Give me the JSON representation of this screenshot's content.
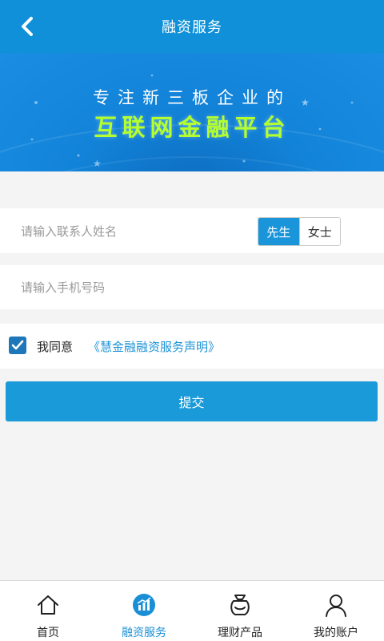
{
  "header": {
    "title": "融资服务",
    "back_icon": "chevron-left-icon"
  },
  "banner": {
    "line1": "专注新三板企业的",
    "line2": "互联网金融平台"
  },
  "form": {
    "name_placeholder": "请输入联系人姓名",
    "gender_options": [
      "先生",
      "女士"
    ],
    "gender_selected": "先生",
    "phone_placeholder": "请输入手机号码",
    "agree_checked": true,
    "agree_label": "我同意",
    "agree_link": "《慧金融融资服务声明》",
    "submit_label": "提交"
  },
  "tabs": [
    {
      "label": "首页",
      "icon": "home-icon",
      "active": false
    },
    {
      "label": "融资服务",
      "icon": "financing-chart-icon",
      "active": true
    },
    {
      "label": "理财产品",
      "icon": "money-bag-icon",
      "active": false
    },
    {
      "label": "我的账户",
      "icon": "user-icon",
      "active": false
    }
  ],
  "colors": {
    "accent": "#1a95da",
    "header": "#0f90d8",
    "banner_highlight": "#b4ff2e"
  }
}
